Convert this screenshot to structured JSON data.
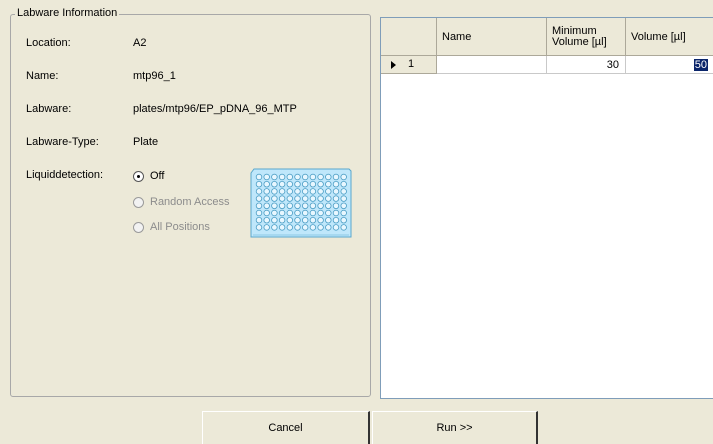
{
  "labware": {
    "group_title": "Labware Information",
    "location_label": "Location:",
    "location_value": "A2",
    "name_label": "Name:",
    "name_value": "mtp96_1",
    "labware_label": "Labware:",
    "labware_value": "plates/mtp96/EP_pDNA_96_MTP",
    "type_label": "Labware-Type:",
    "type_value": "Plate",
    "liquid_label": "Liquiddetection:",
    "options": [
      {
        "label": "Off",
        "checked": true,
        "enabled": true
      },
      {
        "label": "Random Access",
        "checked": false,
        "enabled": false
      },
      {
        "label": "All Positions",
        "checked": false,
        "enabled": false
      }
    ],
    "plate_icon": "microplate-96-icon",
    "plate_color": "#bfe7fb"
  },
  "grid": {
    "columns": [
      "Name",
      "Minimum\nVolume [µl]",
      "Volume [µl]"
    ],
    "rows": [
      {
        "index": "1",
        "name": "",
        "min_volume": "30",
        "volume": "50"
      }
    ],
    "selection_color": "#0a246a"
  },
  "buttons": {
    "cancel": "Cancel",
    "run": "Run >>"
  }
}
